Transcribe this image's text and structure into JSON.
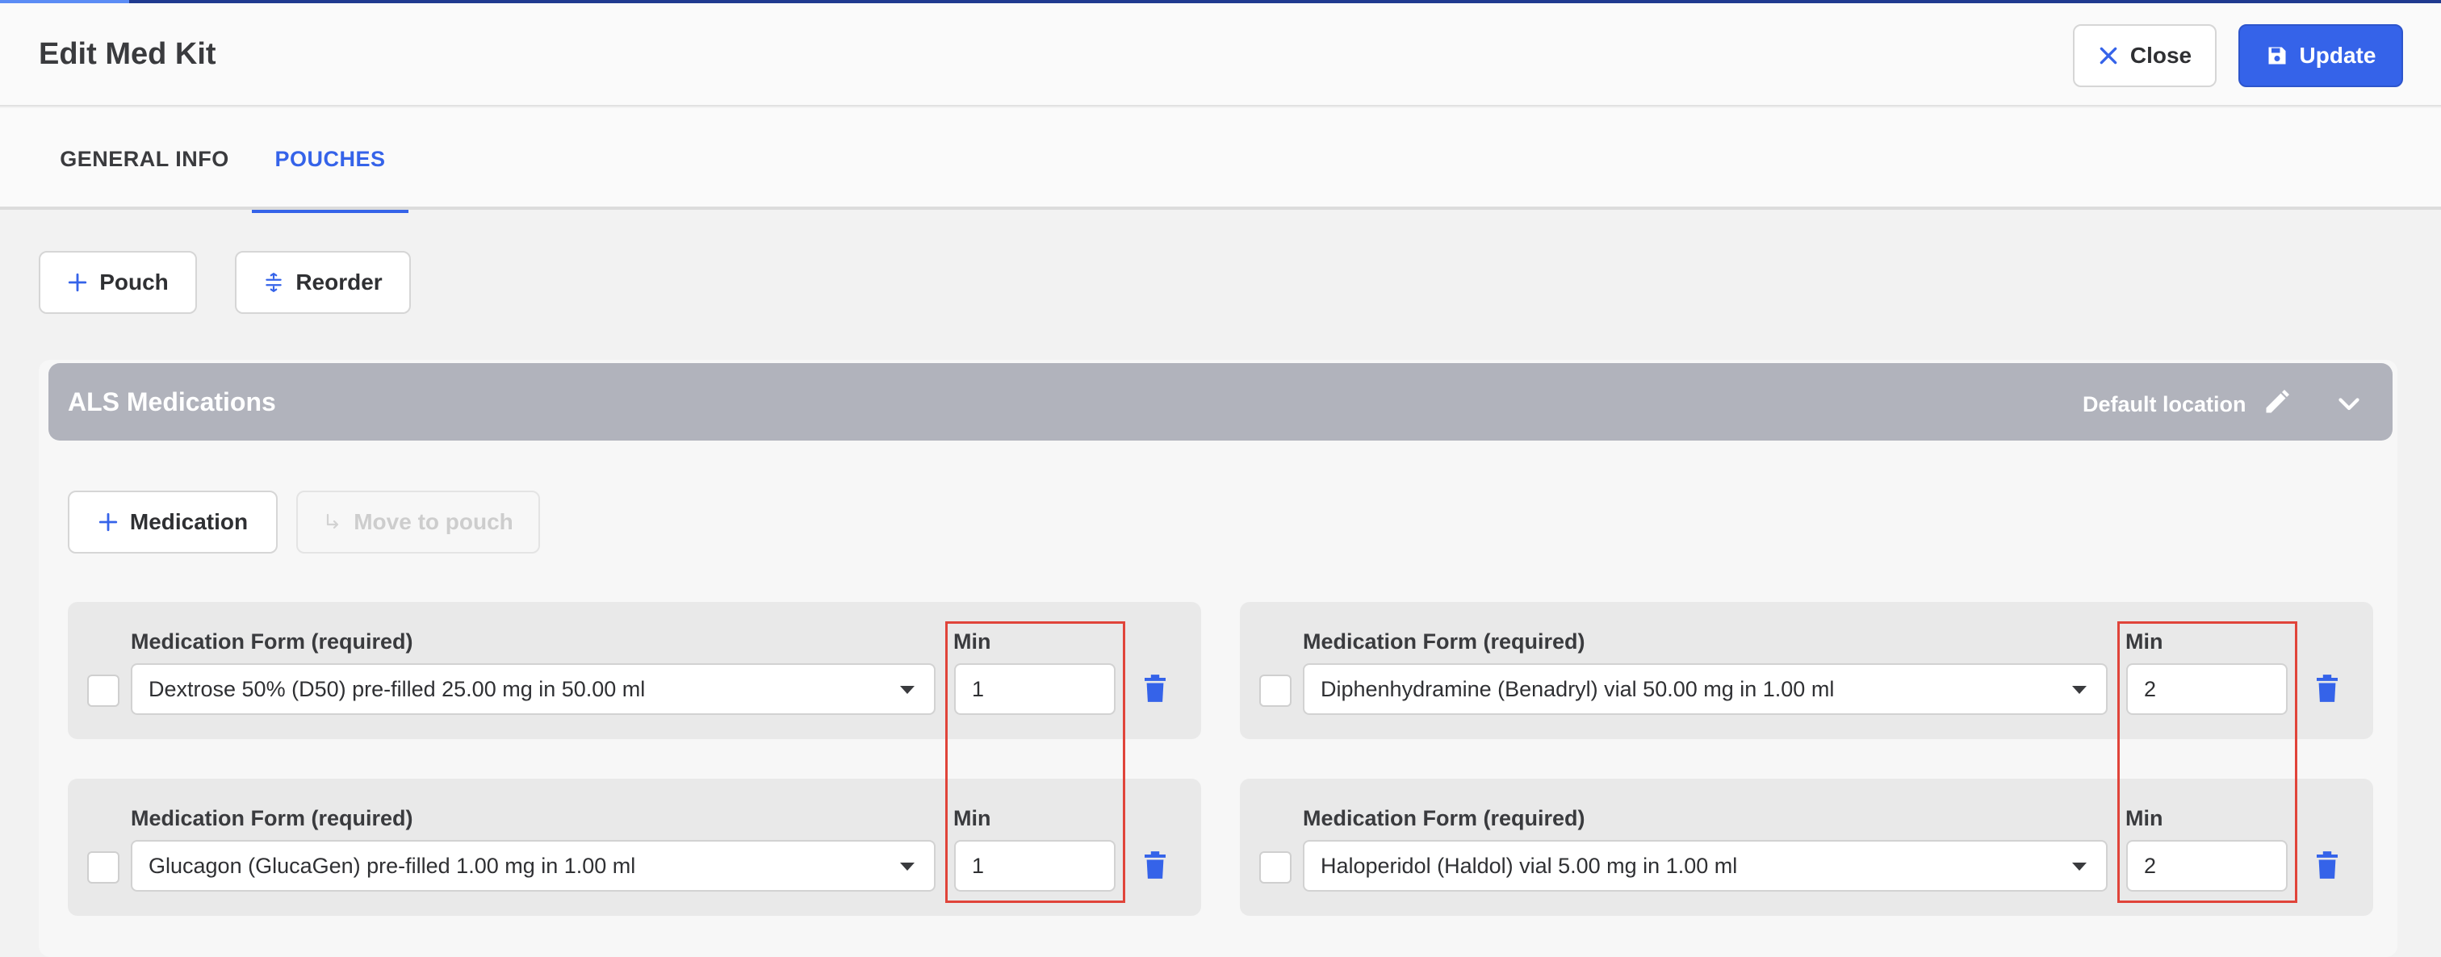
{
  "page": {
    "title": "Edit Med Kit"
  },
  "header": {
    "close_label": "Close",
    "update_label": "Update"
  },
  "tabs": [
    {
      "label": "GENERAL INFO",
      "active": false
    },
    {
      "label": "POUCHES",
      "active": true
    }
  ],
  "toolbar": {
    "pouch_label": "Pouch",
    "reorder_label": "Reorder"
  },
  "pouch": {
    "title": "ALS Medications",
    "location": "Default location",
    "add_medication_label": "Medication",
    "move_label": "Move to pouch",
    "form_label": "Medication Form (required)",
    "min_label": "Min",
    "items": [
      {
        "form": "Dextrose 50% (D50) pre-filled 25.00 mg in 50.00 ml",
        "min": "1"
      },
      {
        "form": "Diphenhydramine (Benadryl) vial 50.00 mg in 1.00 ml",
        "min": "2"
      },
      {
        "form": "Glucagon (GlucaGen) pre-filled 1.00 mg in 1.00 ml",
        "min": "1"
      },
      {
        "form": "Haloperidol (Haldol) vial 5.00 mg in 1.00 ml",
        "min": "2"
      }
    ]
  },
  "colors": {
    "primary": "#3563e9",
    "pouch_header": "#b1b3bc",
    "highlight": "#e0443a",
    "delete_icon": "#3563e9"
  }
}
